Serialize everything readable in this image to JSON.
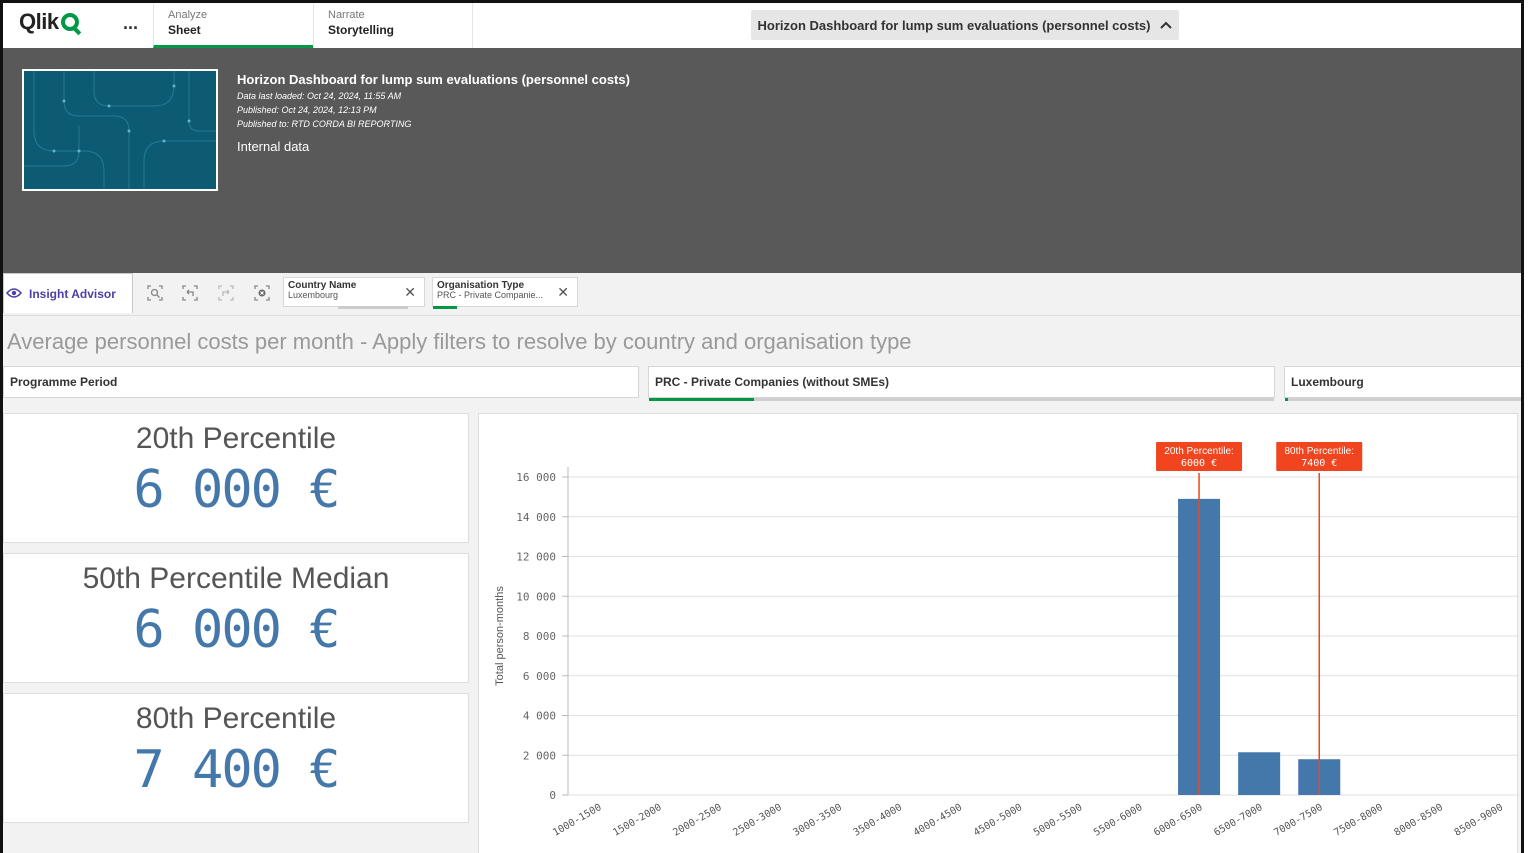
{
  "topbar": {
    "logo": "Qlik",
    "more": "...",
    "tabs": [
      {
        "small": "Analyze",
        "big": "Sheet"
      },
      {
        "small": "Narrate",
        "big": "Storytelling"
      }
    ],
    "app_title": "Horizon Dashboard for lump sum evaluations (personnel costs)",
    "chevron": "^"
  },
  "header": {
    "title": "Horizon Dashboard for lump sum evaluations (personnel costs)",
    "loaded": "Data last loaded: Oct 24, 2024, 11:55 AM",
    "published": "Published: Oct 24, 2024, 12:13 PM",
    "published_to": "Published to: RTD CORDA BI REPORTING",
    "description": "Internal data"
  },
  "toolbar": {
    "insight_label": "Insight Advisor",
    "chips": [
      {
        "name": "Country Name",
        "value": "Luxembourg"
      },
      {
        "name": "Organisation Type",
        "value": "PRC - Private Companie..."
      }
    ]
  },
  "sheet": {
    "title": "Average personnel costs per month - Apply filters to resolve by country and organisation type",
    "filters": [
      {
        "label": "Programme Period"
      },
      {
        "label": "PRC - Private Companies (without SMEs)"
      },
      {
        "label": "Luxembourg"
      }
    ]
  },
  "kpis": [
    {
      "label": "20th Percentile",
      "value": "6 000 €"
    },
    {
      "label": "50th Percentile Median",
      "value": "6 000 €"
    },
    {
      "label": "80th Percentile",
      "value": "7 400 €"
    }
  ],
  "chart_data": {
    "type": "bar",
    "ylabel": "Total person-months",
    "ylim": [
      0,
      16000
    ],
    "yticks": [
      0,
      2000,
      4000,
      6000,
      8000,
      10000,
      12000,
      14000,
      16000
    ],
    "ytick_labels": [
      "0",
      "2 000",
      "4 000",
      "6 000",
      "8 000",
      "10 000",
      "12 000",
      "14 000",
      "16 000"
    ],
    "categories": [
      "1000-1500",
      "1500-2000",
      "2000-2500",
      "2500-3000",
      "3000-3500",
      "3500-4000",
      "4000-4500",
      "4500-5000",
      "5000-5500",
      "5500-6000",
      "6000-6500",
      "6500-7000",
      "7000-7500",
      "7500-8000",
      "8000-8500",
      "8500-9000"
    ],
    "values": [
      0,
      0,
      0,
      0,
      0,
      0,
      0,
      0,
      0,
      0,
      14900,
      2150,
      1800,
      0,
      0,
      0
    ],
    "color": "#4477aa",
    "grid": true,
    "reference_lines": [
      {
        "label": "20th Percentile:",
        "value_label": "6000 €",
        "category_index": 10,
        "color": "#f0451e"
      },
      {
        "label": "80th Percentile:",
        "value_label": "7400 €",
        "category_index": 12,
        "color": "#f0451e"
      }
    ]
  }
}
